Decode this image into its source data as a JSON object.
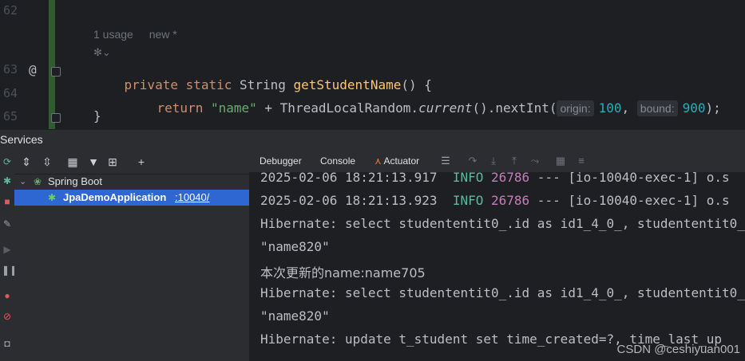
{
  "editor": {
    "line_numbers": [
      "62",
      "63",
      "64",
      "65"
    ],
    "gutter_marker": "@",
    "meta_usage": "1 usage",
    "meta_new": "new *",
    "code": {
      "sig_private": "private",
      "sig_static": "static",
      "sig_type": "String",
      "sig_name": "getStudentName",
      "sig_rest": "() {",
      "ret_kw": "return",
      "ret_str": "\"name\"",
      "ret_plus": " + ",
      "ret_class": "ThreadLocalRandom.",
      "ret_current": "current",
      "ret_mid": "().nextInt(",
      "hint_origin": "origin:",
      "val_origin": "100",
      "comma": ", ",
      "hint_bound": "bound:",
      "val_bound": "900",
      "ret_end": ");",
      "close_brace": "}"
    }
  },
  "services": {
    "title": "Services",
    "tree": {
      "spring_boot": "Spring Boot",
      "app_name": "JpaDemoApplication",
      "app_port": ":10040/"
    }
  },
  "console": {
    "tabs": {
      "debugger": "Debugger",
      "console": "Console",
      "actuator": "Actuator"
    },
    "lines": [
      {
        "date": "2025-02-06 18:21:13.917",
        "level": "INFO",
        "pid": "26786",
        "rest": " --- [io-10040-exec-1] o.s"
      },
      {
        "date": "2025-02-06 18:21:13.923",
        "level": "INFO",
        "pid": "26786",
        "rest": " --- [io-10040-exec-1] o.s"
      }
    ],
    "text_lines": [
      "Hibernate: select studententit0_.id as id1_4_0_, studententit0_",
      "\"name820\"",
      "本次更新的name:name705",
      "Hibernate: select studententit0_.id as id1_4_0_, studententit0_",
      "\"name820\"",
      "Hibernate: update t_student set time_created=?, time_last_up"
    ]
  },
  "watermark": "CSDN @ceshiyuan001",
  "colors": {
    "selection": "#2e67d1",
    "editor_bg": "#1e1f22",
    "panel_bg": "#2b2d30"
  }
}
